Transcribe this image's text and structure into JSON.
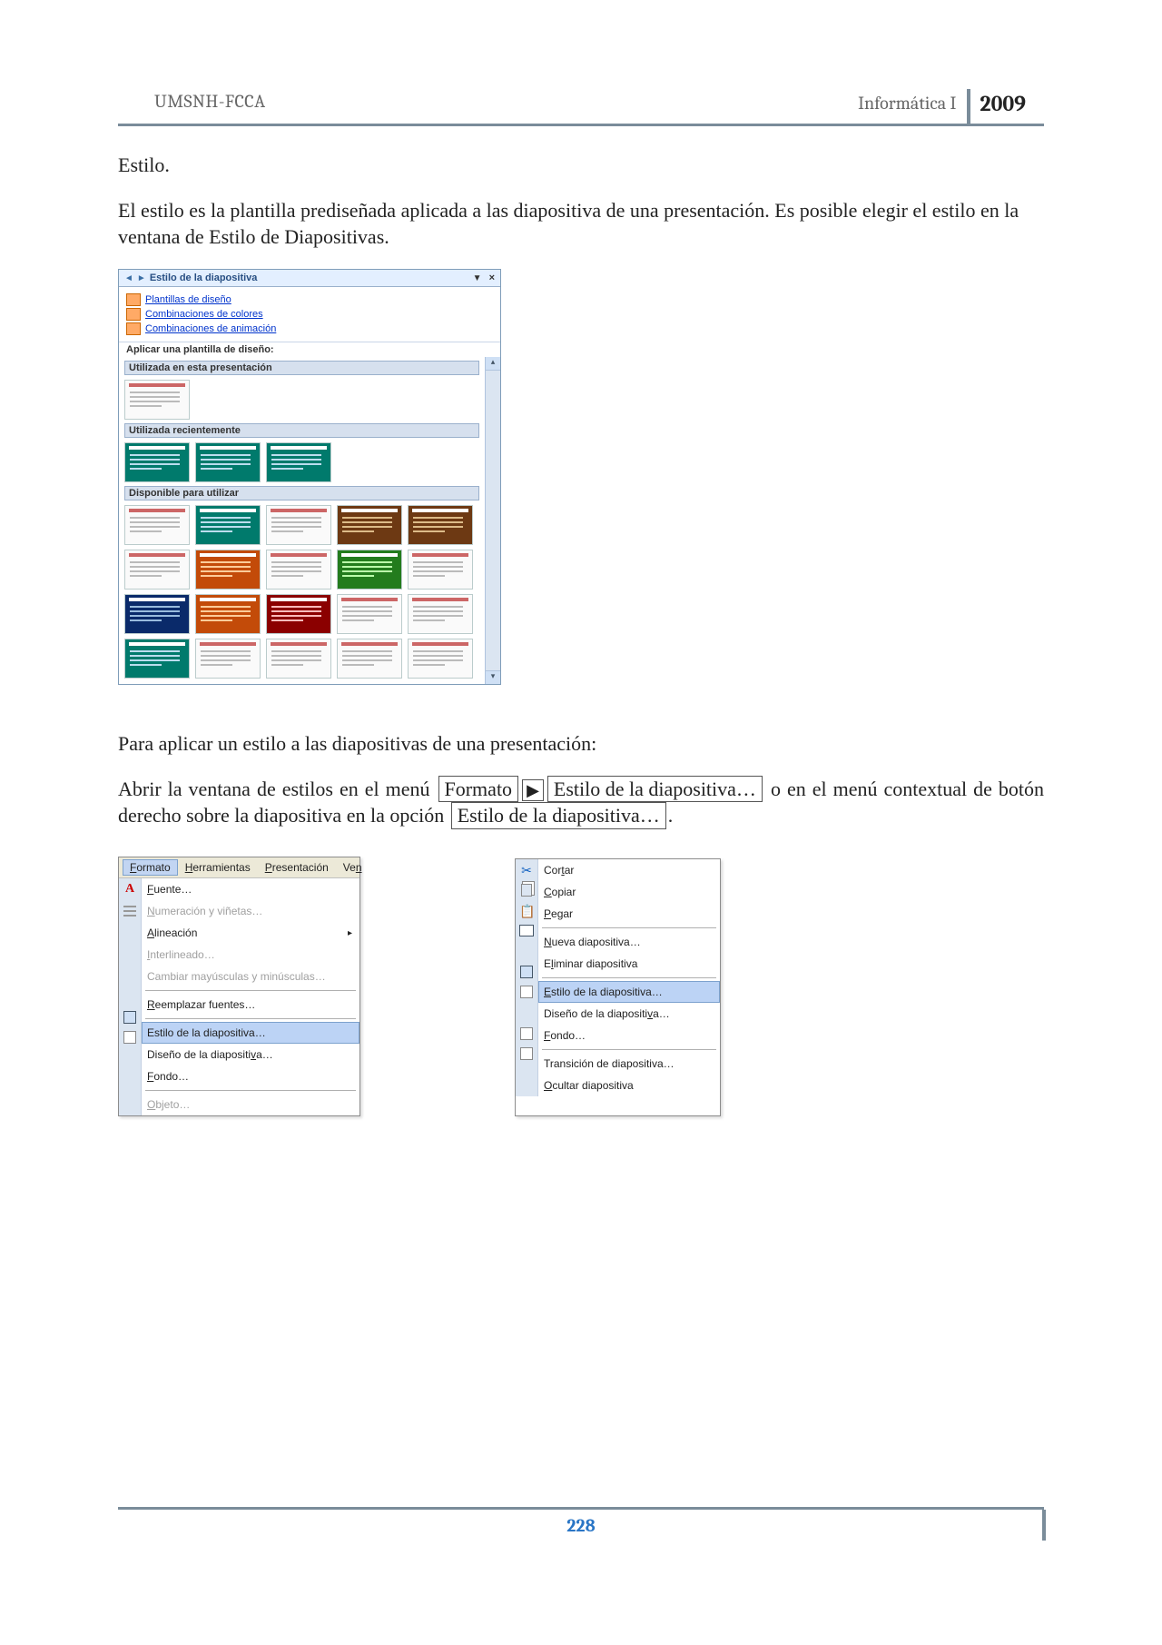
{
  "header": {
    "left": "UMSNH-FCCA",
    "course": "Informática I",
    "year": "2009"
  },
  "text": {
    "heading": "Estilo.",
    "p1": "El estilo es la plantilla prediseñada aplicada a las diapositiva de una presentación. Es posible elegir el estilo en la ventana de Estilo de Diapositivas.",
    "p2": "Para aplicar un estilo a las diapositivas de una presentación:",
    "p3a": "Abrir la ventana de estilos en el menú ",
    "p3_box1": "Formato",
    "p3b": " ",
    "p3_box2": "Estilo de la diapositiva…",
    "p3c": " o en el menú contextual de botón derecho sobre la diapositiva en la opción ",
    "p3_box3": "Estilo de la diapositiva…",
    "p3d": "."
  },
  "taskpane": {
    "title": "Estilo de la diapositiva",
    "links": {
      "templates": "Plantillas de diseño",
      "colors": "Combinaciones de colores",
      "anim": "Combinaciones de animación"
    },
    "apply_label": "Aplicar una plantilla de diseño:",
    "section_used": "Utilizada en esta presentación",
    "section_recent": "Utilizada recientemente",
    "section_available": "Disponible para utilizar"
  },
  "menu1": {
    "bar": {
      "formato": "Formato",
      "herramientas": "Herramientas",
      "presentacion": "Presentación",
      "ven": "Ven"
    },
    "items": {
      "fuente": "Fuente…",
      "numeracion": "Numeración y viñetas…",
      "alineacion": "Alineación",
      "interlineado": "Interlineado…",
      "mayus": "Cambiar mayúsculas y minúsculas…",
      "reemplazar": "Reemplazar fuentes…",
      "estilo": "Estilo de la diapositiva…",
      "diseno": "Diseño de la diapositiva…",
      "fondo": "Fondo…",
      "objeto": "Objeto…"
    }
  },
  "menu2": {
    "items": {
      "cortar": "Cortar",
      "copiar": "Copiar",
      "pegar": "Pegar",
      "nueva": "Nueva diapositiva…",
      "eliminar": "Eliminar diapositiva",
      "estilo": "Estilo de la diapositiva…",
      "diseno": "Diseño de la diapositiva…",
      "fondo": "Fondo…",
      "transicion": "Transición de diapositiva…",
      "ocultar": "Ocultar diapositiva"
    }
  },
  "footer": {
    "page": "228"
  }
}
